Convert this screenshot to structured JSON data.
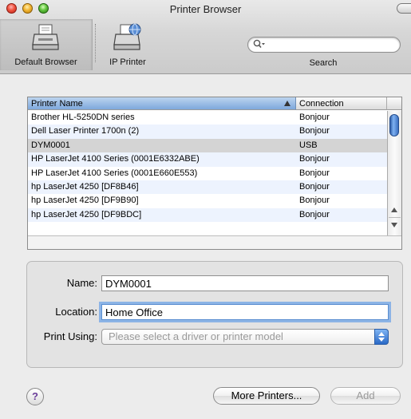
{
  "window": {
    "title": "Printer Browser"
  },
  "toolbar": {
    "default_browser_label": "Default Browser",
    "ip_printer_label": "IP Printer",
    "search_label": "Search",
    "search_placeholder": "",
    "search_value": ""
  },
  "table": {
    "columns": [
      "Printer Name",
      "Connection"
    ],
    "sort_column": "Printer Name",
    "rows": [
      {
        "name": "Brother HL-5250DN series",
        "connection": "Bonjour"
      },
      {
        "name": "Dell Laser Printer 1700n (2)",
        "connection": "Bonjour"
      },
      {
        "name": "DYM0001",
        "connection": "USB",
        "selected": true
      },
      {
        "name": "HP LaserJet 4100 Series (0001E6332ABE)",
        "connection": "Bonjour"
      },
      {
        "name": "HP LaserJet 4100 Series (0001E660E553)",
        "connection": "Bonjour"
      },
      {
        "name": "hp LaserJet 4250 [DF8B46]",
        "connection": "Bonjour"
      },
      {
        "name": "hp LaserJet 4250 [DF9B90]",
        "connection": "Bonjour"
      },
      {
        "name": "hp LaserJet 4250 [DF9BDC]",
        "connection": "Bonjour"
      }
    ]
  },
  "details": {
    "name_label": "Name:",
    "name_value": "DYM0001",
    "location_label": "Location:",
    "location_value": "Home Office",
    "print_using_label": "Print Using:",
    "print_using_value": "Please select a driver or printer model"
  },
  "footer": {
    "help_glyph": "?",
    "more_printers_label": "More Printers...",
    "add_label": "Add"
  },
  "colors": {
    "header_selected": "#7ea8dc",
    "row_alt": "#edf3fe",
    "row_selected": "#d4d4d4",
    "focus_ring": "#8cb4e6"
  }
}
